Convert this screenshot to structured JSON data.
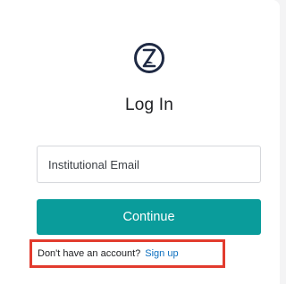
{
  "login": {
    "title": "Log In",
    "email_placeholder": "Institutional Email",
    "continue_label": "Continue",
    "signup_prompt": "Don't have an account?",
    "signup_link": "Sign up"
  },
  "icons": {
    "logo": "hourglass-logo-icon"
  },
  "colors": {
    "accent": "#0a9c9b",
    "link": "#0b6fbf",
    "highlight_border": "#e23b2e",
    "logo": "#1f2a44"
  }
}
